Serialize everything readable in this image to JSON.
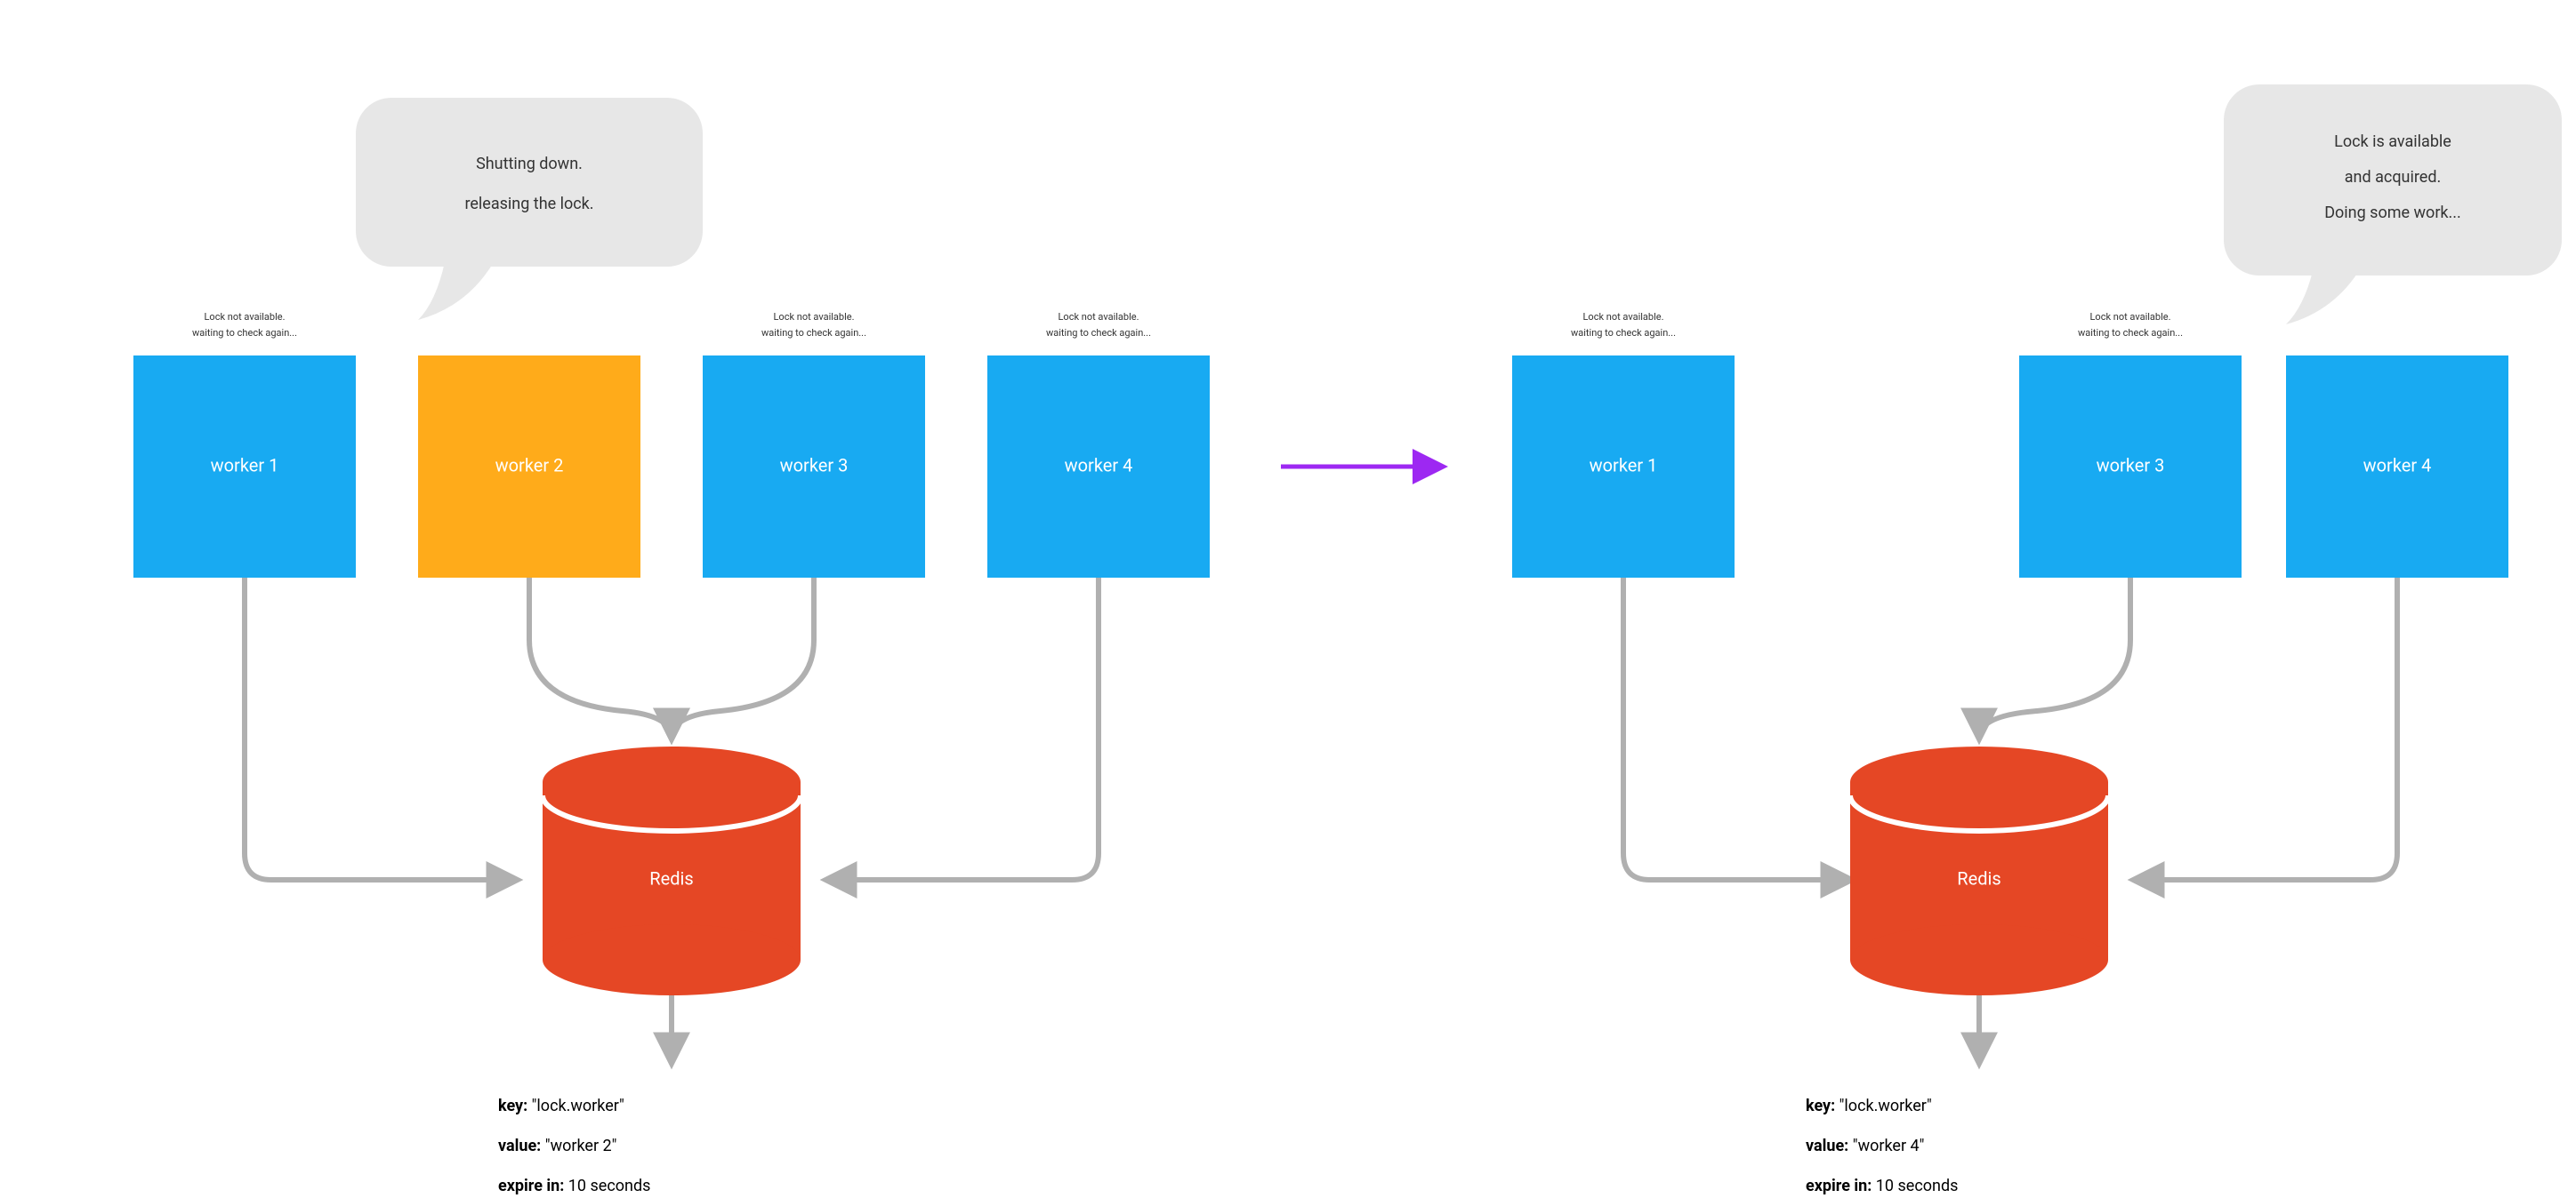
{
  "colors": {
    "blue": "#18aaf2",
    "orange": "#ffab1a",
    "redis": "#e54725",
    "bubble": "#e7e7e7",
    "arrowGray": "#b0b0b0",
    "arrowPurple": "#9d28f2"
  },
  "captions": {
    "notAvail1": "Lock not available.",
    "notAvail2": "waiting to check again..."
  },
  "bubbles": {
    "left": {
      "line1": "Shutting down.",
      "line2": "releasing the lock."
    },
    "right": {
      "line1": "Lock is available",
      "line2": "and acquired.",
      "line3": "Doing some work..."
    }
  },
  "left": {
    "workers": [
      "worker 1",
      "worker 2",
      "worker 3",
      "worker 4"
    ],
    "redis": "Redis",
    "info": {
      "keyLabel": "key:",
      "keyValue": "\"lock.worker\"",
      "valueLabel": "value:",
      "valueValue": "\"worker 2\"",
      "expireLabel": "expire in:",
      "expireValue": "10 seconds"
    }
  },
  "right": {
    "workers": [
      "worker 1",
      "worker 3",
      "worker 4"
    ],
    "redis": "Redis",
    "info": {
      "keyLabel": "key:",
      "keyValue": "\"lock.worker\"",
      "valueLabel": "value:",
      "valueValue": "\"worker 4\"",
      "expireLabel": "expire in:",
      "expireValue": "10 seconds"
    }
  }
}
